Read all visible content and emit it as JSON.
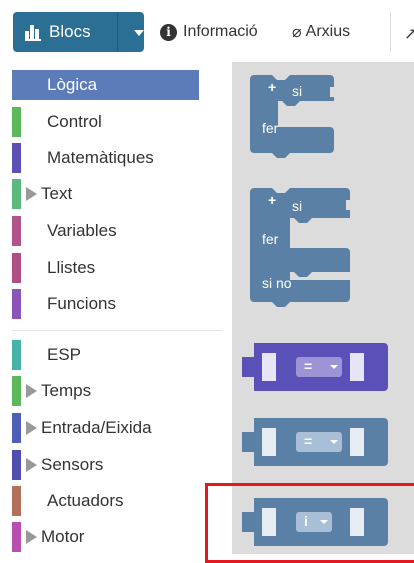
{
  "toolbar": {
    "blocs_label": "Blocs",
    "info_label": "Informació",
    "info_icon": "info-icon",
    "arxius_label": "Arxius",
    "arxius_icon": "paperclip-icon",
    "right_partial": "↗"
  },
  "categories": [
    {
      "label": "Lògica",
      "color": "#5b7cb8",
      "arrow": false,
      "selected": true
    },
    {
      "label": "Control",
      "color": "#5cb85c",
      "arrow": false,
      "selected": false
    },
    {
      "label": "Matemàtiques",
      "color": "#5b4fb8",
      "arrow": false,
      "selected": false
    },
    {
      "label": "Text",
      "color": "#5cb87c",
      "arrow": true,
      "selected": false
    },
    {
      "label": "Variables",
      "color": "#b0558a",
      "arrow": false,
      "selected": false
    },
    {
      "label": "Llistes",
      "color": "#b04f86",
      "arrow": false,
      "selected": false
    },
    {
      "label": "Funcions",
      "color": "#8a55b8",
      "arrow": false,
      "selected": false
    },
    {
      "label": "ESP",
      "color": "#47b3a8",
      "arrow": false,
      "selected": false
    },
    {
      "label": "Temps",
      "color": "#5cb85c",
      "arrow": true,
      "selected": false
    },
    {
      "label": "Entrada/Eixida",
      "color": "#4f5fb8",
      "arrow": true,
      "selected": false
    },
    {
      "label": "Sensors",
      "color": "#4f4fb0",
      "arrow": true,
      "selected": false
    },
    {
      "label": "Actuadors",
      "color": "#b0705a",
      "arrow": false,
      "selected": false
    },
    {
      "label": "Motor",
      "color": "#b84fb0",
      "arrow": true,
      "selected": false
    }
  ],
  "flyout": {
    "if_block": {
      "plus": "+",
      "si": "si",
      "fer": "fer"
    },
    "ifelse_block": {
      "plus": "+",
      "si": "si",
      "fer": "fer",
      "sino": "si no"
    },
    "compare_purple": {
      "op": "="
    },
    "compare_blue": {
      "op": "="
    },
    "logic_op": {
      "op": "i"
    }
  },
  "colors": {
    "toolbar_blue": "#2b6f94",
    "logic_block": "#5b80a5",
    "math_block": "#5b4fb8",
    "highlight": "#e8161c"
  }
}
